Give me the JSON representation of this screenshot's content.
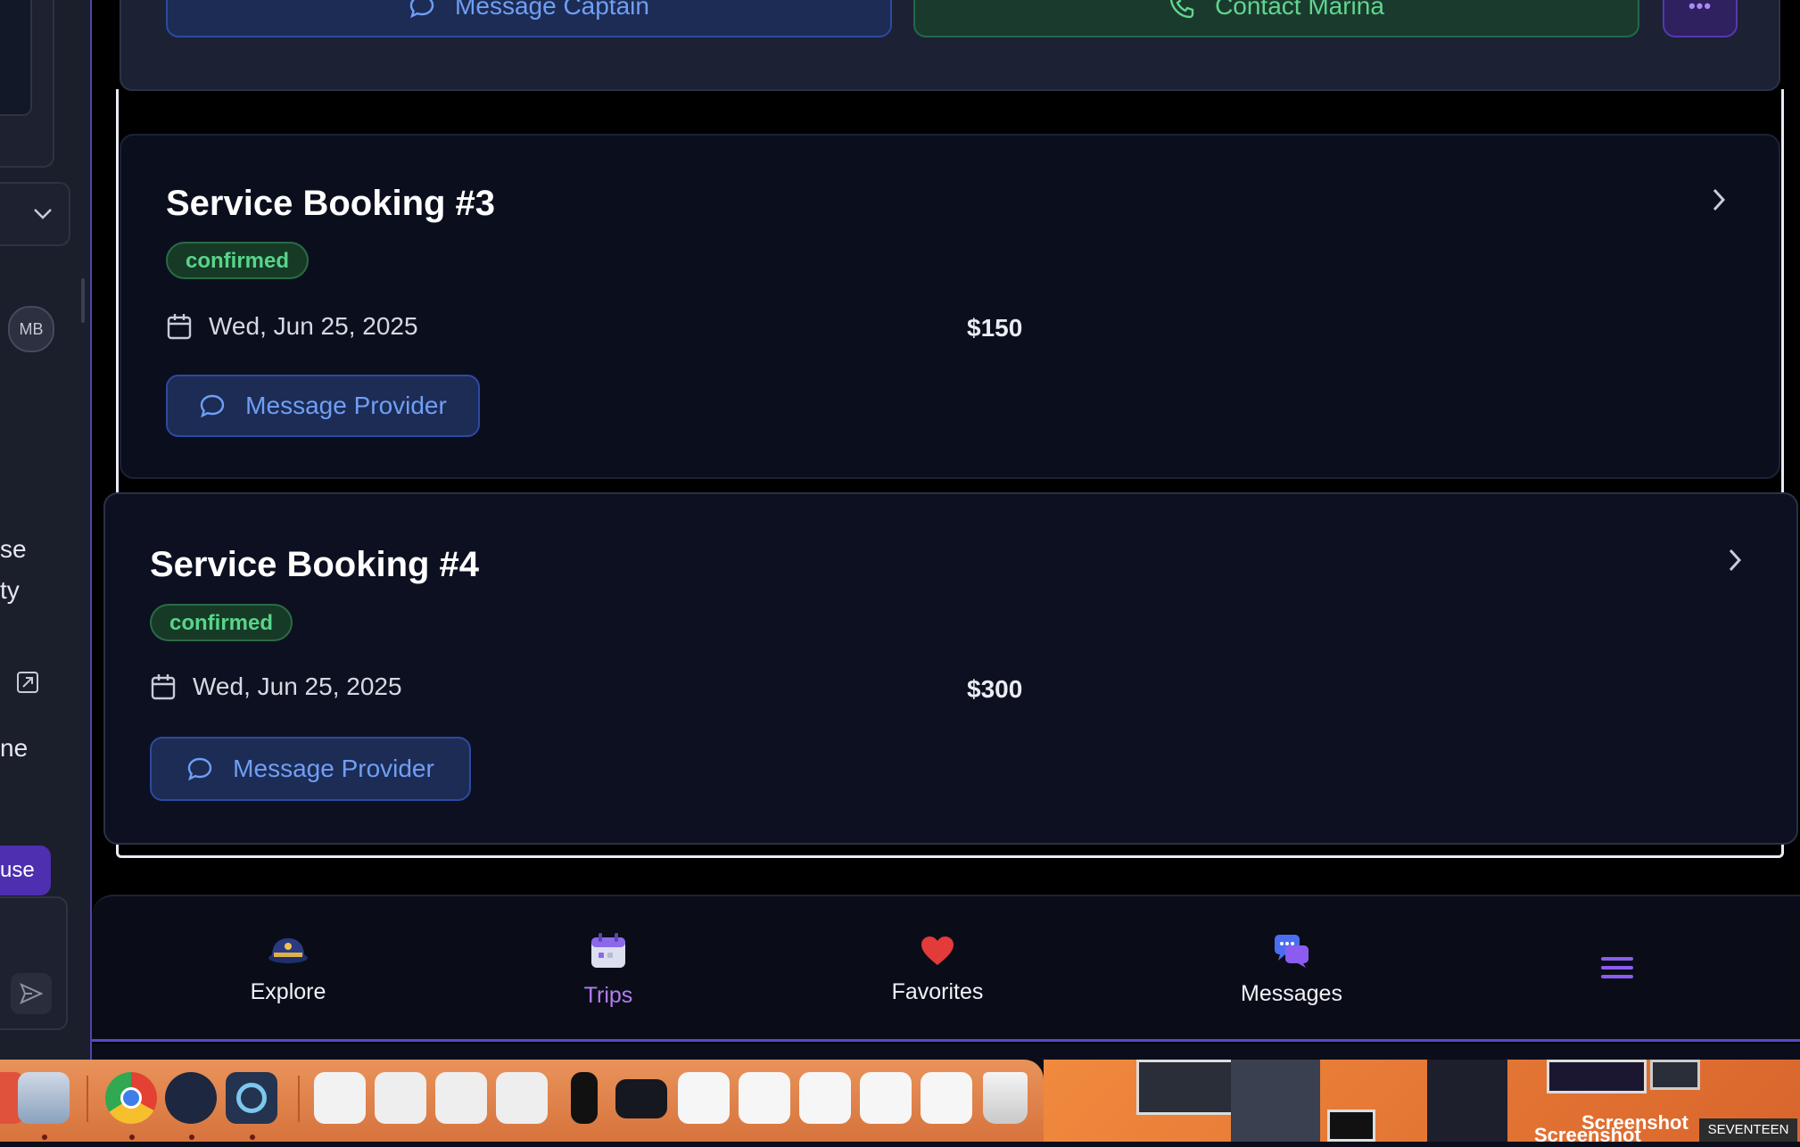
{
  "left_panel": {
    "avatar_initials": "MB",
    "partial_text_1": "se",
    "partial_text_2": "ty",
    "partial_text_3": "ne",
    "partial_button": "use"
  },
  "top_card": {
    "message_captain": "Message Captain",
    "contact_marina": "Contact Marina",
    "more_label": "•••"
  },
  "bookings": [
    {
      "title": "Service Booking #3",
      "status": "confirmed",
      "date": "Wed, Jun 25, 2025",
      "price": "$150",
      "action": "Message Provider"
    },
    {
      "title": "Service Booking #4",
      "status": "confirmed",
      "date": "Wed, Jun 25, 2025",
      "price": "$300",
      "action": "Message Provider"
    }
  ],
  "bottom_nav": {
    "items": [
      {
        "label": "Explore",
        "icon": "captain-hat-icon",
        "active": false
      },
      {
        "label": "Trips",
        "icon": "calendar-icon",
        "active": true
      },
      {
        "label": "Favorites",
        "icon": "heart-icon",
        "active": false
      },
      {
        "label": "Messages",
        "icon": "chat-bubbles-icon",
        "active": false
      }
    ],
    "menu_icon": "hamburger-menu-icon",
    "active_color": "#b37cf0"
  },
  "desktop": {
    "label_1": "Screenshot",
    "label_2": "Screenshot",
    "label_3": "SEVENTEEN"
  },
  "colors": {
    "accent_purple": "#6d4bd8",
    "status_green": "#58d58a",
    "link_blue": "#6f9ff5"
  }
}
